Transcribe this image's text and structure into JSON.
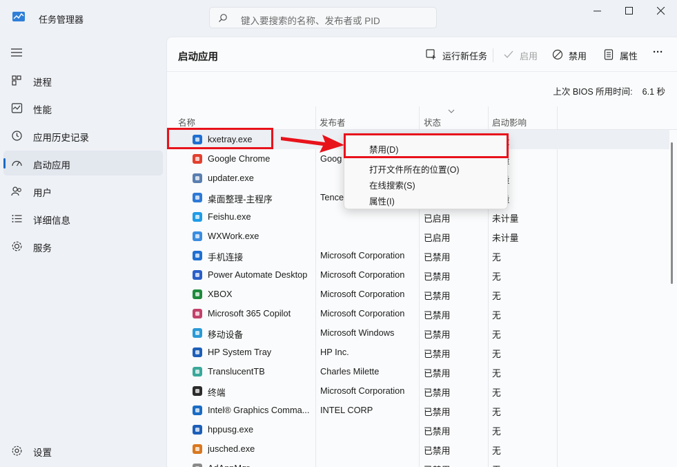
{
  "window": {
    "title": "任务管理器",
    "search_placeholder": "键入要搜索的名称、发布者或 PID"
  },
  "sidebar": {
    "items": [
      {
        "label": "进程",
        "icon": "processes-icon"
      },
      {
        "label": "性能",
        "icon": "performance-icon"
      },
      {
        "label": "应用历史记录",
        "icon": "history-icon"
      },
      {
        "label": "启动应用",
        "icon": "startup-icon",
        "active": true
      },
      {
        "label": "用户",
        "icon": "users-icon"
      },
      {
        "label": "详细信息",
        "icon": "details-icon"
      },
      {
        "label": "服务",
        "icon": "services-icon"
      }
    ],
    "settings_label": "设置"
  },
  "main": {
    "title": "启动应用",
    "toolbar": {
      "run_new_task": "运行新任务",
      "enable": "启用",
      "disable": "禁用",
      "properties": "属性",
      "more": "···"
    },
    "bios_label": "上次 BIOS 所用时间:",
    "bios_value": "6.1 秒",
    "columns": [
      "名称",
      "发布者",
      "状态",
      "启动影响"
    ],
    "rows": [
      {
        "name": "kxetray.exe",
        "publisher": "",
        "status": "",
        "impact": "计量",
        "icon_color": "#1f6fd1"
      },
      {
        "name": "Google Chrome",
        "publisher": "Goog",
        "status": "",
        "impact": "计量",
        "icon_color": "#e3402f"
      },
      {
        "name": "updater.exe",
        "publisher": "",
        "status": "",
        "impact": "计量",
        "icon_color": "#5a7fb0"
      },
      {
        "name": "桌面整理-主程序",
        "publisher": "Tence",
        "status": "",
        "impact": "计量",
        "icon_color": "#2d7ad6"
      },
      {
        "name": "Feishu.exe",
        "publisher": "",
        "status": "已启用",
        "impact": "未计量",
        "icon_color": "#1f9ce8"
      },
      {
        "name": "WXWork.exe",
        "publisher": "",
        "status": "已启用",
        "impact": "未计量",
        "icon_color": "#3a8de0"
      },
      {
        "name": "手机连接",
        "publisher": "Microsoft Corporation",
        "status": "已禁用",
        "impact": "无",
        "icon_color": "#1f6fd1"
      },
      {
        "name": "Power Automate Desktop",
        "publisher": "Microsoft Corporation",
        "status": "已禁用",
        "impact": "无",
        "icon_color": "#2a5fc9"
      },
      {
        "name": "XBOX",
        "publisher": "Microsoft Corporation",
        "status": "已禁用",
        "impact": "无",
        "icon_color": "#1e8a3c"
      },
      {
        "name": "Microsoft 365 Copilot",
        "publisher": "Microsoft Corporation",
        "status": "已禁用",
        "impact": "无",
        "icon_color": "#c2426b"
      },
      {
        "name": "移动设备",
        "publisher": "Microsoft Windows",
        "status": "已禁用",
        "impact": "无",
        "icon_color": "#2a9ad6"
      },
      {
        "name": "HP System Tray",
        "publisher": "HP Inc.",
        "status": "已禁用",
        "impact": "无",
        "icon_color": "#1c5fb8"
      },
      {
        "name": "TranslucentTB",
        "publisher": "Charles Milette",
        "status": "已禁用",
        "impact": "无",
        "icon_color": "#3aa89a"
      },
      {
        "name": "终端",
        "publisher": "Microsoft Corporation",
        "status": "已禁用",
        "impact": "无",
        "icon_color": "#2b2b2b"
      },
      {
        "name": "Intel® Graphics Comma...",
        "publisher": "INTEL CORP",
        "status": "已禁用",
        "impact": "无",
        "icon_color": "#1a6cc4"
      },
      {
        "name": "hppusg.exe",
        "publisher": "",
        "status": "已禁用",
        "impact": "无",
        "icon_color": "#1c5fb8"
      },
      {
        "name": "jusched.exe",
        "publisher": "",
        "status": "已禁用",
        "impact": "无",
        "icon_color": "#d9781f"
      },
      {
        "name": "AdAppMgr...",
        "publisher": "",
        "status": "已禁用",
        "impact": "无",
        "icon_color": "#8a8a8a"
      }
    ]
  },
  "context_menu": {
    "items": [
      "禁用(D)",
      "打开文件所在的位置(O)",
      "在线搜索(S)",
      "属性(I)"
    ]
  },
  "colors": {
    "annotation": "#e8121b",
    "accent": "#1b6ac4"
  }
}
